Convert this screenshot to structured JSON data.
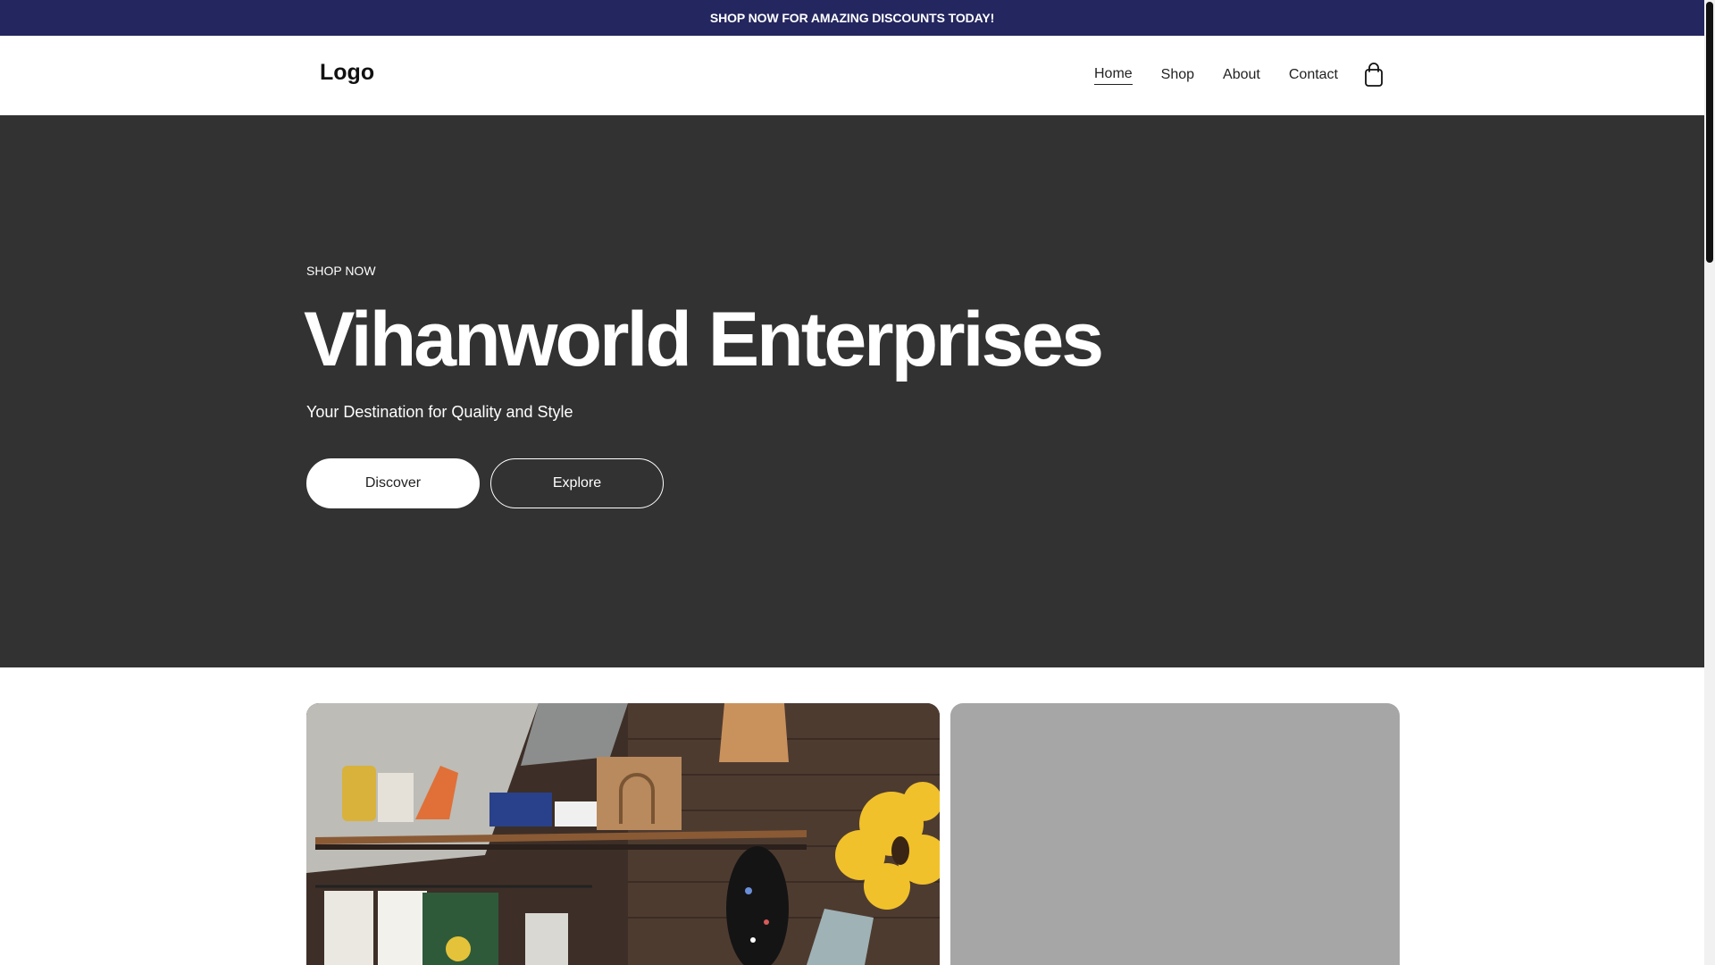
{
  "announcement": {
    "text": "SHOP NOW FOR AMAZING DISCOUNTS TODAY!"
  },
  "header": {
    "logo": "Logo",
    "nav": [
      {
        "label": "Home",
        "active": true
      },
      {
        "label": "Shop",
        "active": false
      },
      {
        "label": "About",
        "active": false
      },
      {
        "label": "Contact",
        "active": false
      }
    ],
    "cart_icon": "shopping-bag-icon"
  },
  "hero": {
    "eyebrow": "SHOP NOW",
    "title": "Vihanworld Enterprises",
    "subtitle": "Your Destination for Quality and Style",
    "primary_button": "Discover",
    "secondary_button": "Explore"
  },
  "colors": {
    "announcement_bg": "#24265f",
    "hero_bg": "#323232",
    "placeholder_card": "#a6a6a6",
    "text_light": "#ffffff",
    "text_dark": "#111111"
  }
}
